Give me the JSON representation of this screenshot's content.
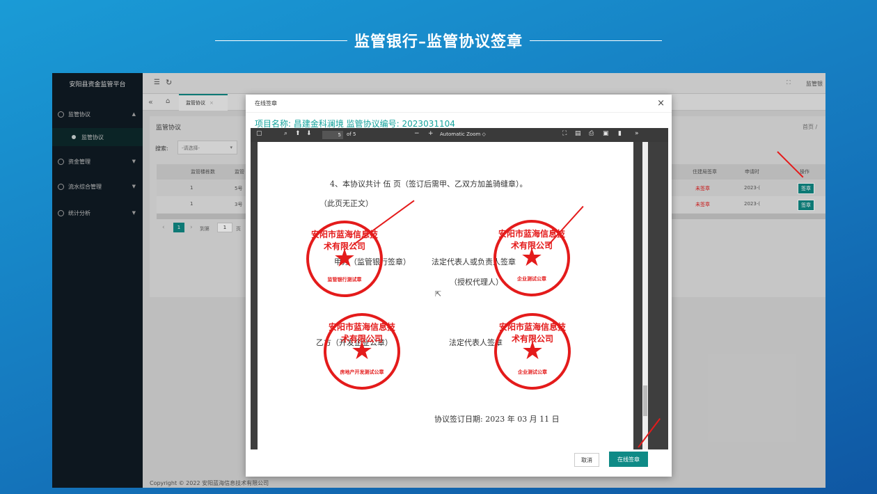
{
  "slide": {
    "title": "监管银行–监管协议签章"
  },
  "app": {
    "logo": "安阳县资金监管平台",
    "sidebar": [
      {
        "label": "监管协议",
        "expanded": true
      },
      {
        "label": "监管协议",
        "sub": true
      },
      {
        "label": "资金管理"
      },
      {
        "label": "流水综合管理"
      },
      {
        "label": "统计分析"
      }
    ],
    "topbar": {
      "right_label": "监管银"
    },
    "tab": "监管协议",
    "panel_title": "监管协议",
    "breadcrumb": "首页 /",
    "search_label": "搜索:",
    "search_placeholder": "-请选择-",
    "columns": [
      "监管楼栋数",
      "监管",
      "住建局签章",
      "申请时",
      "操作"
    ],
    "rows": [
      {
        "a": "1",
        "b": "5号",
        "status": "未签章",
        "date": "2023-(",
        "action": "签章"
      },
      {
        "a": "1",
        "b": "3号",
        "status": "未签章",
        "date": "2023-(",
        "action": "签章"
      }
    ],
    "pager": {
      "page": "1",
      "goto": "到第",
      "input": "1",
      "unit": "页"
    },
    "footer": "Copyright © 2022 安阳蓝海信息技术有限公司"
  },
  "modal": {
    "title": "在线签章",
    "project": "项目名称: 昌建金科澜境    监管协议编号: 2023031104",
    "viewer": {
      "page": "5",
      "of": "of 5",
      "zoom": "Automatic Zoom"
    },
    "doc": {
      "line1": "4、本协议共计  伍  页（签订后需甲、乙双方加盖骑缝章）。",
      "line2": "（此页无正文）",
      "party_a": "甲方（监管银行签章）",
      "rep_a": "法定代表人或负责人签章",
      "agent": "（授权代理人）",
      "party_b": "乙方（开发企业公章）",
      "rep_b": "法定代表人签章",
      "date": "协议签订日期:    2023 年 03 月 11 日"
    },
    "seals": [
      {
        "arc": "安阳市蓝海信息技术有限公司",
        "bottom": "监管银行测试章"
      },
      {
        "arc": "安阳市蓝海信息技术有限公司",
        "bottom": "企业测试公章"
      },
      {
        "arc": "安阳市蓝海信息技术有限公司",
        "bottom": "房地产开发测试公章"
      },
      {
        "arc": "安阳市蓝海信息技术有限公司",
        "bottom": "企业测试公章"
      }
    ],
    "cancel": "取消",
    "sign": "在线签章"
  }
}
